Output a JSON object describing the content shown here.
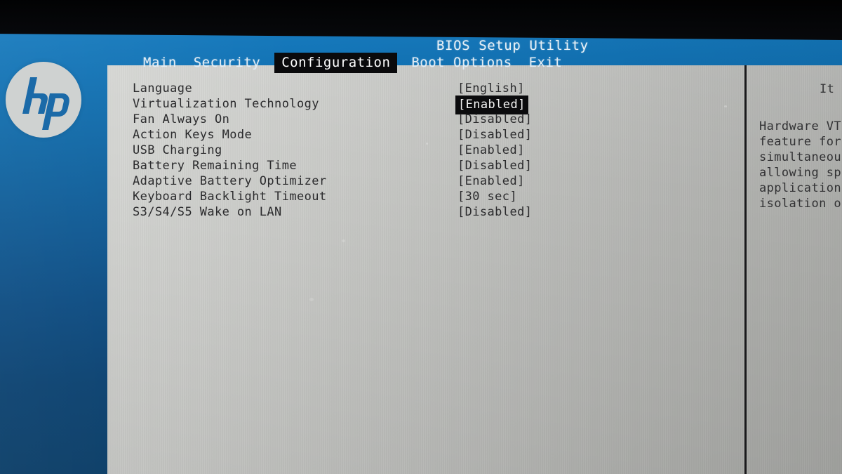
{
  "window": {
    "title": "BIOS Setup Utility",
    "vendor_logo": "hp-logo"
  },
  "menubar": {
    "items": [
      {
        "label": "Main",
        "active": false
      },
      {
        "label": "Security",
        "active": false
      },
      {
        "label": "Configuration",
        "active": true
      },
      {
        "label": "Boot Options",
        "active": false
      },
      {
        "label": "Exit",
        "active": false
      }
    ]
  },
  "settings": {
    "rows": [
      {
        "label": "Language",
        "value": "[English]",
        "selected": false
      },
      {
        "label": "Virtualization Technology",
        "value": "[Enabled]",
        "selected": true
      },
      {
        "label": "Fan Always On",
        "value": "[Disabled]",
        "selected": false
      },
      {
        "label": "Action Keys Mode",
        "value": "[Disabled]",
        "selected": false
      },
      {
        "label": "USB Charging",
        "value": "[Enabled]",
        "selected": false
      },
      {
        "label": "Battery Remaining Time",
        "value": "[Disabled]",
        "selected": false
      },
      {
        "label": "Adaptive Battery Optimizer",
        "value": "[Enabled]",
        "selected": false
      },
      {
        "label": "Keyboard Backlight Timeout",
        "value": "[30 sec]",
        "selected": false
      },
      {
        "label": "S3/S4/S5 Wake on LAN",
        "value": "[Disabled]",
        "selected": false
      }
    ]
  },
  "help": {
    "title": "It",
    "lines": [
      "Hardware VT",
      "feature for",
      "simultaneou",
      "allowing sp",
      "application",
      "isolation o"
    ]
  },
  "colors": {
    "header_blue": "#0f66a4",
    "panel_gray": "#c6c7c4",
    "highlight_black": "#0b0b0d",
    "text_dark": "#2b2b2d",
    "header_text": "#e9f1f7",
    "bezel_black": "#000000"
  }
}
